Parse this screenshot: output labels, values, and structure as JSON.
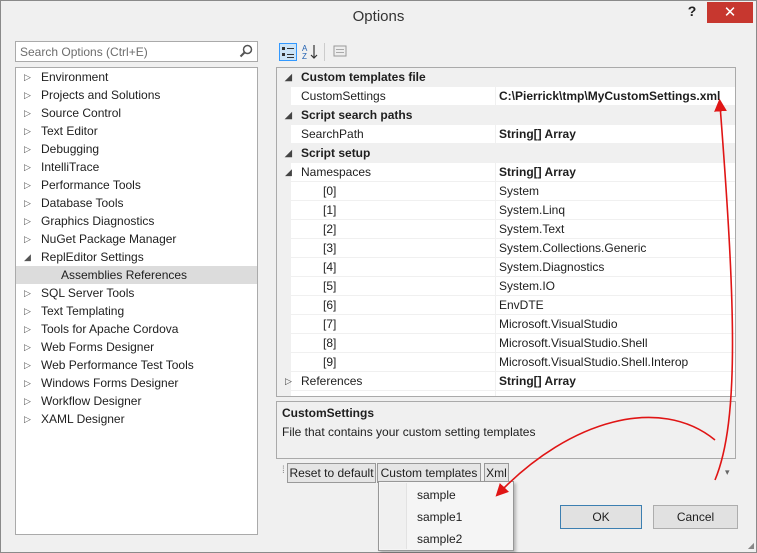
{
  "window": {
    "title": "Options",
    "help": "?",
    "close": "✕"
  },
  "search": {
    "placeholder": "Search Options (Ctrl+E)"
  },
  "tree": [
    {
      "label": "Environment",
      "arrow": "▷"
    },
    {
      "label": "Projects and Solutions",
      "arrow": "▷"
    },
    {
      "label": "Source Control",
      "arrow": "▷"
    },
    {
      "label": "Text Editor",
      "arrow": "▷"
    },
    {
      "label": "Debugging",
      "arrow": "▷"
    },
    {
      "label": "IntelliTrace",
      "arrow": "▷"
    },
    {
      "label": "Performance Tools",
      "arrow": "▷"
    },
    {
      "label": "Database Tools",
      "arrow": "▷"
    },
    {
      "label": "Graphics Diagnostics",
      "arrow": "▷"
    },
    {
      "label": "NuGet Package Manager",
      "arrow": "▷"
    },
    {
      "label": "ReplEditor Settings",
      "arrow": "◢"
    },
    {
      "label": "Assemblies References",
      "arrow": ""
    },
    {
      "label": "SQL Server Tools",
      "arrow": "▷"
    },
    {
      "label": "Text Templating",
      "arrow": "▷"
    },
    {
      "label": "Tools for Apache Cordova",
      "arrow": "▷"
    },
    {
      "label": "Web Forms Designer",
      "arrow": "▷"
    },
    {
      "label": "Web Performance Test Tools",
      "arrow": "▷"
    },
    {
      "label": "Windows Forms Designer",
      "arrow": "▷"
    },
    {
      "label": "Workflow Designer",
      "arrow": "▷"
    },
    {
      "label": "XAML Designer",
      "arrow": "▷"
    }
  ],
  "grid": [
    {
      "type": "cat",
      "glyph": "◢",
      "name": "Custom templates file"
    },
    {
      "type": "prop",
      "name": "CustomSettings",
      "value": "C:\\Pierrick\\tmp\\MyCustomSettings.xml",
      "bold": true
    },
    {
      "type": "cat",
      "glyph": "◢",
      "name": "Script search paths"
    },
    {
      "type": "prop",
      "name": "SearchPath",
      "value": "String[] Array",
      "bold": true
    },
    {
      "type": "cat",
      "glyph": "◢",
      "name": "Script setup"
    },
    {
      "type": "prop",
      "glyph": "◢",
      "name": "Namespaces",
      "value": "String[] Array",
      "bold": true
    },
    {
      "type": "idx",
      "name": "[0]",
      "value": "System"
    },
    {
      "type": "idx",
      "name": "[1]",
      "value": "System.Linq"
    },
    {
      "type": "idx",
      "name": "[2]",
      "value": "System.Text"
    },
    {
      "type": "idx",
      "name": "[3]",
      "value": "System.Collections.Generic"
    },
    {
      "type": "idx",
      "name": "[4]",
      "value": "System.Diagnostics"
    },
    {
      "type": "idx",
      "name": "[5]",
      "value": "System.IO"
    },
    {
      "type": "idx",
      "name": "[6]",
      "value": "EnvDTE"
    },
    {
      "type": "idx",
      "name": "[7]",
      "value": "Microsoft.VisualStudio"
    },
    {
      "type": "idx",
      "name": "[8]",
      "value": "Microsoft.VisualStudio.Shell"
    },
    {
      "type": "idx",
      "name": "[9]",
      "value": "Microsoft.VisualStudio.Shell.Interop"
    },
    {
      "type": "prop",
      "glyph": "▷",
      "name": "References",
      "value": "String[] Array",
      "bold": true
    }
  ],
  "description": {
    "title": "CustomSettings",
    "text": "File that contains your custom setting templates"
  },
  "bottom": {
    "reset": "Reset to default",
    "templates": "Custom templates",
    "xml": "Xml"
  },
  "menu": [
    "sample",
    "sample1",
    "sample2"
  ],
  "buttons": {
    "ok": "OK",
    "cancel": "Cancel"
  },
  "colors": {
    "accent_arrow": "#e01515",
    "selection": "#dcdcdc",
    "close": "#c7372f"
  }
}
